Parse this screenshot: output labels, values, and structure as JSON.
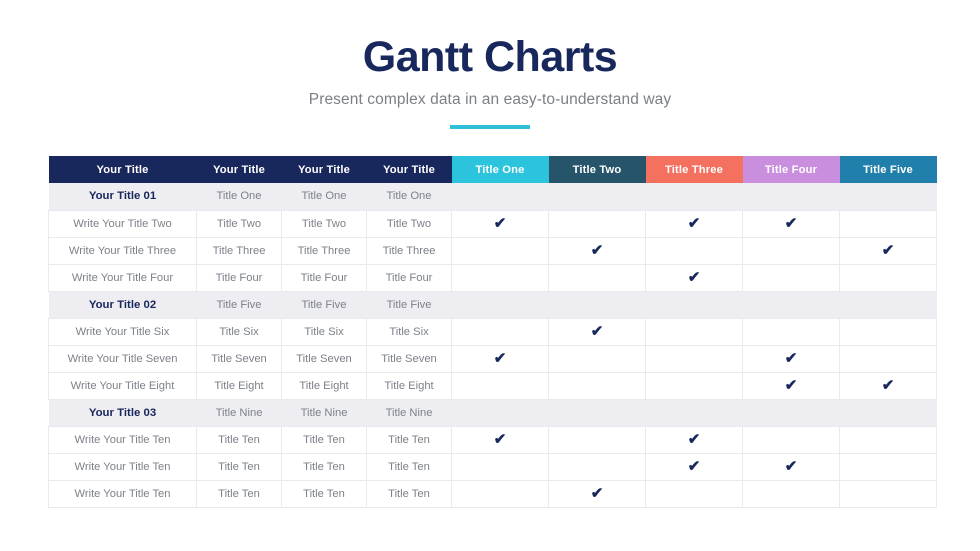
{
  "header": {
    "title": "Gantt Charts",
    "subtitle": "Present complex data in an easy-to-understand way"
  },
  "colors": {
    "navy": "#18275c",
    "accent": "#2fc0d8",
    "title_one": "#2cc4dd",
    "title_two": "#26546b",
    "title_three": "#f4705f",
    "title_four": "#c98ede",
    "title_five": "#2080ab",
    "group_row_bg": "#eeeef2",
    "body_text": "#7c8189",
    "grid_line": "#e9eaee"
  },
  "table": {
    "columns": [
      {
        "label": "Your Title",
        "kind": "label",
        "bg": "#18275c"
      },
      {
        "label": "Your Title",
        "kind": "text",
        "bg": "#18275c"
      },
      {
        "label": "Your Title",
        "kind": "text",
        "bg": "#18275c"
      },
      {
        "label": "Your Title",
        "kind": "text",
        "bg": "#18275c"
      },
      {
        "label": "Title One",
        "kind": "mark",
        "bg": "#2cc4dd"
      },
      {
        "label": "Title Two",
        "kind": "mark",
        "bg": "#26546b"
      },
      {
        "label": "Title Three",
        "kind": "mark",
        "bg": "#f4705f"
      },
      {
        "label": "Title Four",
        "kind": "mark",
        "bg": "#c98ede"
      },
      {
        "label": "Title Five",
        "kind": "mark",
        "bg": "#2080ab"
      }
    ],
    "check_glyph": "✔",
    "rows": [
      {
        "type": "group",
        "cells": [
          "Your Title 01",
          "Title One",
          "Title One",
          "Title One"
        ],
        "marks": [
          false,
          false,
          false,
          false,
          false
        ]
      },
      {
        "type": "item",
        "cells": [
          "Write Your Title Two",
          "Title Two",
          "Title Two",
          "Title Two"
        ],
        "marks": [
          true,
          false,
          true,
          true,
          false
        ]
      },
      {
        "type": "item",
        "cells": [
          "Write Your Title Three",
          "Title Three",
          "Title Three",
          "Title Three"
        ],
        "marks": [
          false,
          true,
          false,
          false,
          true
        ]
      },
      {
        "type": "item",
        "cells": [
          "Write Your Title Four",
          "Title Four",
          "Title Four",
          "Title Four"
        ],
        "marks": [
          false,
          false,
          true,
          false,
          false
        ]
      },
      {
        "type": "group",
        "cells": [
          "Your Title 02",
          "Title Five",
          "Title Five",
          "Title Five"
        ],
        "marks": [
          false,
          false,
          false,
          false,
          false
        ]
      },
      {
        "type": "item",
        "cells": [
          "Write Your Title Six",
          "Title Six",
          "Title Six",
          "Title Six"
        ],
        "marks": [
          false,
          true,
          false,
          false,
          false
        ]
      },
      {
        "type": "item",
        "cells": [
          "Write Your Title Seven",
          "Title Seven",
          "Title Seven",
          "Title Seven"
        ],
        "marks": [
          true,
          false,
          false,
          true,
          false
        ]
      },
      {
        "type": "item",
        "cells": [
          "Write Your Title Eight",
          "Title Eight",
          "Title Eight",
          "Title Eight"
        ],
        "marks": [
          false,
          false,
          false,
          true,
          true
        ]
      },
      {
        "type": "group",
        "cells": [
          "Your Title 03",
          "Title Nine",
          "Title Nine",
          "Title Nine"
        ],
        "marks": [
          false,
          false,
          false,
          false,
          false
        ]
      },
      {
        "type": "item",
        "cells": [
          "Write Your Title Ten",
          "Title Ten",
          "Title Ten",
          "Title Ten"
        ],
        "marks": [
          true,
          false,
          true,
          false,
          false
        ]
      },
      {
        "type": "item",
        "cells": [
          "Write Your Title Ten",
          "Title Ten",
          "Title Ten",
          "Title Ten"
        ],
        "marks": [
          false,
          false,
          true,
          true,
          false
        ]
      },
      {
        "type": "item",
        "cells": [
          "Write Your Title Ten",
          "Title Ten",
          "Title Ten",
          "Title Ten"
        ],
        "marks": [
          false,
          true,
          false,
          false,
          false
        ]
      }
    ]
  }
}
